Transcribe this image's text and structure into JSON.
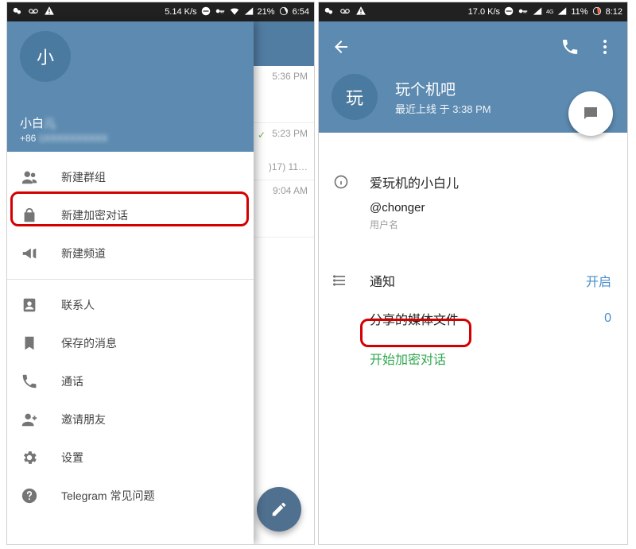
{
  "left": {
    "status": {
      "speed": "5.14 K/s",
      "battery": "21%",
      "time": "6:54"
    },
    "drawer": {
      "avatar_letter": "小",
      "name": "小白",
      "phone": "+86",
      "phone_rest": "1XXXXXXXXXX"
    },
    "menu": {
      "new_group": "新建群组",
      "new_secret": "新建加密对话",
      "new_channel": "新建频道",
      "contacts": "联系人",
      "saved": "保存的消息",
      "calls": "通话",
      "invite": "邀请朋友",
      "settings": "设置",
      "faq": "Telegram 常见问题"
    },
    "chats": {
      "t1": "5:36 PM",
      "t2": "5:23 PM",
      "s2": ")17) 11…",
      "t3": "9:04 AM"
    }
  },
  "right": {
    "status": {
      "speed": "17.0 K/s",
      "net": "4G",
      "battery": "11%",
      "time": "8:12"
    },
    "profile": {
      "avatar_letter": "玩",
      "name": "玩个机吧",
      "sub": "最近上线 于 3:38 PM",
      "info_title": "爱玩机的小白儿",
      "username": "@chonger",
      "username_label": "用户名"
    },
    "rows": {
      "notifications": "通知",
      "notifications_value": "开启",
      "shared_media": "分享的媒体文件",
      "shared_media_value": "0",
      "start_secret": "开始加密对话"
    }
  }
}
